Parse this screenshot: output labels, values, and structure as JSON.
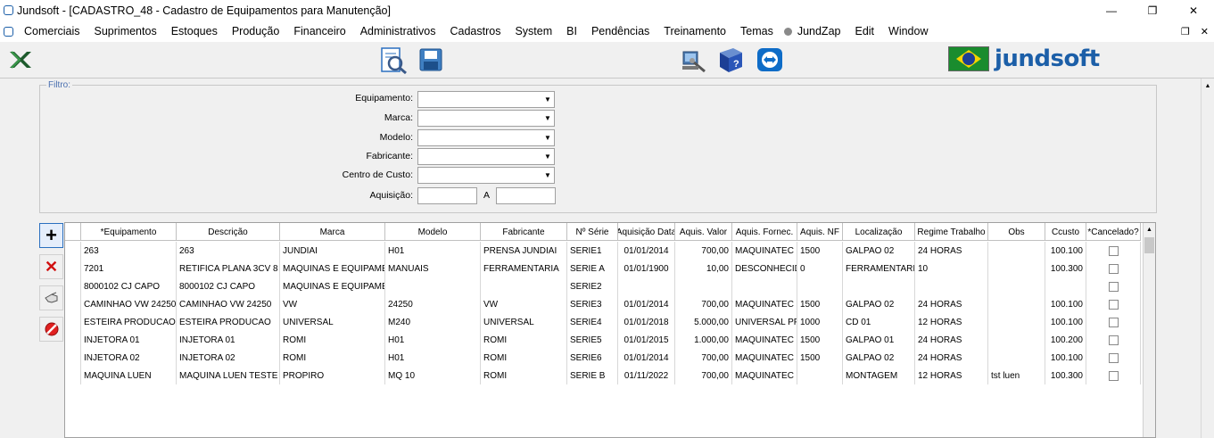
{
  "window": {
    "title": "Jundsoft - [CADASTRO_48 - Cadastro de Equipamentos para Manutenção]",
    "minimize": "—",
    "restore": "❐",
    "close": "✕"
  },
  "menu": {
    "items": [
      "Comerciais",
      "Suprimentos",
      "Estoques",
      "Produção",
      "Financeiro",
      "Administrativos",
      "Cadastros",
      "System",
      "BI",
      "Pendências",
      "Treinamento",
      "Temas"
    ],
    "jundzap": "JundZap",
    "edit": "Edit",
    "window": "Window",
    "mdi_restore": "❐",
    "mdi_close": "✕"
  },
  "brand": {
    "name": "jundsoft"
  },
  "filter": {
    "legend": "Filtro:",
    "equipamento_label": "Equipamento:",
    "marca_label": "Marca:",
    "modelo_label": "Modelo:",
    "fabricante_label": "Fabricante:",
    "centro_custo_label": "Centro de Custo:",
    "aquisicao_label": "Aquisição:",
    "aquisicao_sep": "A",
    "dropdown_arrow": "▼"
  },
  "grid": {
    "columns": [
      "*Equipamento",
      "Descrição",
      "Marca",
      "Modelo",
      "Fabricante",
      "Nº Série",
      "Aquisição Data",
      "Aquis. Valor",
      "Aquis. Fornec.",
      "Aquis. NF",
      "Localização",
      "Regime Trabalho",
      "Obs",
      "Ccusto",
      "*Cancelado?"
    ],
    "rows": [
      [
        "263",
        "263",
        "JUNDIAI",
        "H01",
        "PRENSA JUNDIAI",
        "SERIE1",
        "01/01/2014",
        "700,00",
        "MAQUINATEC",
        "1500",
        "GALPAO 02",
        "24 HORAS",
        "",
        "100.100"
      ],
      [
        "7201",
        "RETIFICA PLANA   3CV 8",
        "MAQUINAS E EQUIPAME!",
        "MANUAIS",
        "FERRAMENTARIA",
        "SERIE A",
        "01/01/1900",
        "10,00",
        "DESCONHECID",
        "0",
        "FERRAMENTARIA",
        "10",
        "",
        "100.300"
      ],
      [
        "8000102 CJ CAPO",
        "8000102 CJ CAPO",
        "MAQUINAS E EQUIPAME!",
        "",
        "",
        "SERIE2",
        "",
        "",
        "",
        "",
        "",
        "",
        "",
        ""
      ],
      [
        "CAMINHAO VW 24250",
        "CAMINHAO VW 24250",
        "VW",
        "24250",
        "VW",
        "SERIE3",
        "01/01/2014",
        "700,00",
        "MAQUINATEC",
        "1500",
        "GALPAO 02",
        "24 HORAS",
        "",
        "100.100"
      ],
      [
        "ESTEIRA PRODUCAO",
        "ESTEIRA PRODUCAO",
        "UNIVERSAL",
        "M240",
        "UNIVERSAL",
        "SERIE4",
        "01/01/2018",
        "5.000,00",
        "UNIVERSAL PF",
        "1000",
        "CD 01",
        "12 HORAS",
        "",
        "100.100"
      ],
      [
        "INJETORA 01",
        "INJETORA 01",
        "ROMI",
        "H01",
        "ROMI",
        "SERIE5",
        "01/01/2015",
        "1.000,00",
        "MAQUINATEC",
        "1500",
        "GALPAO 01",
        "24 HORAS",
        "",
        "100.200"
      ],
      [
        "INJETORA 02",
        "INJETORA 02",
        "ROMI",
        "H01",
        "ROMI",
        "SERIE6",
        "01/01/2014",
        "700,00",
        "MAQUINATEC",
        "1500",
        "GALPAO 02",
        "24 HORAS",
        "",
        "100.100"
      ],
      [
        "MAQUINA LUEN",
        "MAQUINA LUEN TESTE",
        "PROPIRO",
        "MQ 10",
        "ROMI",
        "SERIE B",
        "01/11/2022",
        "700,00",
        "MAQUINATEC",
        "",
        "MONTAGEM",
        "12 HORAS",
        "tst luen",
        "100.300"
      ]
    ]
  },
  "side_buttons": {
    "add": "+",
    "delete": "✕"
  },
  "scroll": {
    "up": "▲"
  }
}
